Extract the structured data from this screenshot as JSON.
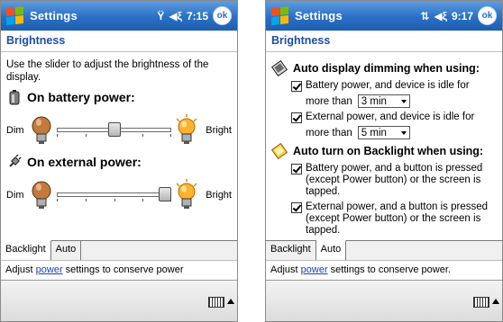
{
  "left": {
    "title": "Settings",
    "time": "7:15",
    "ok_label": "ok",
    "subheader": "Brightness",
    "intro": "Use the slider to adjust the brightness of the display.",
    "battery_section": "On battery power:",
    "external_section": "On external power:",
    "dim_label": "Dim",
    "bright_label": "Bright",
    "battery_level": 0.5,
    "external_level": 1.0,
    "tabs": [
      "Backlight",
      "Auto"
    ],
    "hint_prefix": "Adjust ",
    "hint_link": "power",
    "hint_suffix": " settings to conserve power"
  },
  "right": {
    "title": "Settings",
    "time": "9:17",
    "ok_label": "ok",
    "subheader": "Brightness",
    "dimming_title": "Auto display dimming when using:",
    "dim_battery": "Battery power, and device is idle for",
    "dim_external": "External power, and device is idle for",
    "more_than": "more than",
    "dim_battery_value": "3 min",
    "dim_external_value": "5 min",
    "backlight_title": "Auto turn on Backlight when using:",
    "bl_battery": "Battery power, and a button is pressed (except Power button) or the screen is tapped.",
    "bl_external": "External power, and a button is pressed (except Power button) or the screen is tapped.",
    "tabs": [
      "Backlight",
      "Auto"
    ],
    "hint_prefix": "Adjust ",
    "hint_link": "power",
    "hint_suffix": " settings to conserve power."
  },
  "colors": {
    "titlebar": "#2a6fc6",
    "subheader": "#1b4fa1",
    "link": "#1a3fb8"
  }
}
